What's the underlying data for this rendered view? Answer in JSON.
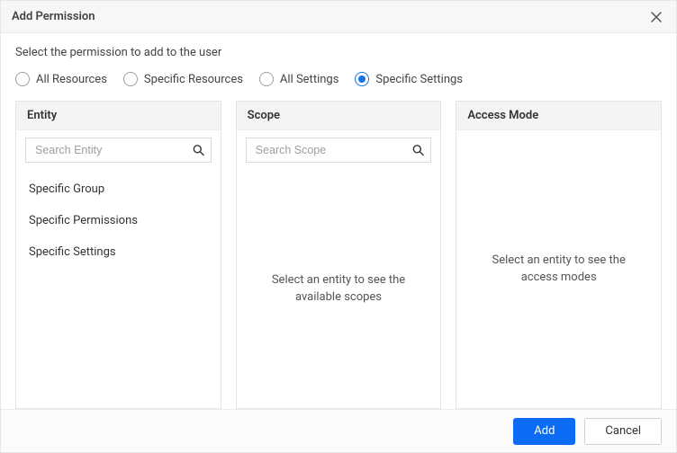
{
  "dialog": {
    "title": "Add Permission",
    "instruction": "Select the permission to add to the user"
  },
  "radios": {
    "items": [
      {
        "label": "All Resources"
      },
      {
        "label": "Specific Resources"
      },
      {
        "label": "All Settings"
      },
      {
        "label": "Specific Settings"
      }
    ],
    "selected_index": 3
  },
  "panels": {
    "entity": {
      "title": "Entity",
      "search_placeholder": "Search Entity",
      "items": [
        "Specific Group",
        "Specific Permissions",
        "Specific Settings"
      ]
    },
    "scope": {
      "title": "Scope",
      "search_placeholder": "Search Scope",
      "empty_message": "Select an entity to see the available scopes"
    },
    "access_mode": {
      "title": "Access Mode",
      "empty_message": "Select an entity to see the access modes"
    }
  },
  "footer": {
    "add_label": "Add",
    "cancel_label": "Cancel"
  }
}
